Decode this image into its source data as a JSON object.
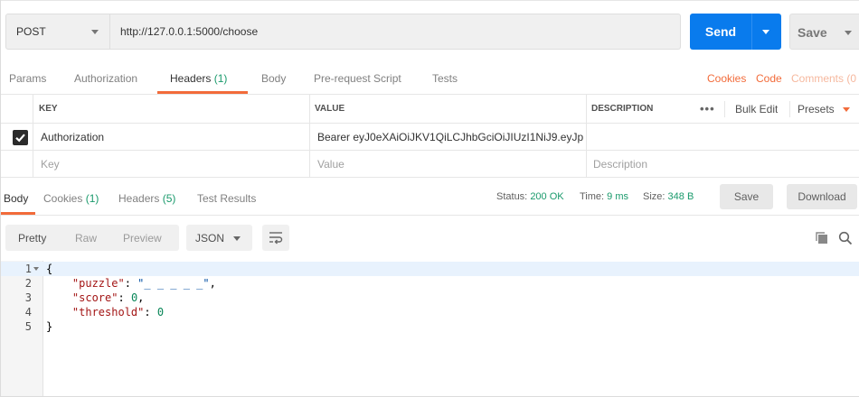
{
  "request": {
    "method": "POST",
    "url": "http://127.0.0.1:5000/choose",
    "send_label": "Send",
    "save_label": "Save"
  },
  "request_tabs": {
    "params": "Params",
    "authorization": "Authorization",
    "headers": "Headers",
    "headers_count": "(1)",
    "body": "Body",
    "prerequest": "Pre-request Script",
    "tests": "Tests",
    "cookies": "Cookies",
    "code": "Code",
    "comments": "Comments (0"
  },
  "headers_table": {
    "col_key": "KEY",
    "col_value": "VALUE",
    "col_description": "DESCRIPTION",
    "dots": "•••",
    "bulk_edit": "Bulk Edit",
    "presets": "Presets",
    "rows": [
      {
        "key": "Authorization",
        "value": "Bearer eyJ0eXAiOiJKV1QiLCJhbGciOiJIUzI1NiJ9.eyJp...",
        "description": "",
        "checked": true
      }
    ],
    "placeholder_key": "Key",
    "placeholder_value": "Value",
    "placeholder_description": "Description"
  },
  "response_tabs": {
    "body": "Body",
    "cookies": "Cookies",
    "cookies_count": "(1)",
    "headers": "Headers",
    "headers_count": "(5)",
    "test_results": "Test Results",
    "status_label": "Status:",
    "status_value": "200 OK",
    "time_label": "Time:",
    "time_value": "9 ms",
    "size_label": "Size:",
    "size_value": "348 B",
    "save_label": "Save",
    "download_label": "Download"
  },
  "response_toolbar": {
    "pretty": "Pretty",
    "raw": "Raw",
    "preview": "Preview",
    "format": "JSON"
  },
  "response_body": {
    "line_numbers": [
      "1",
      "2",
      "3",
      "4",
      "5"
    ],
    "open_brace": "{",
    "close_brace": "}",
    "puzzle_key": "\"puzzle\"",
    "puzzle_value": "\"_ _ _ _ _\"",
    "score_key": "\"score\"",
    "score_value": "0",
    "threshold_key": "\"threshold\"",
    "threshold_value": "0"
  },
  "colors": {
    "send_blue": "#097bed",
    "accent_orange": "#f26b3a",
    "status_green": "#1a9a6c"
  }
}
